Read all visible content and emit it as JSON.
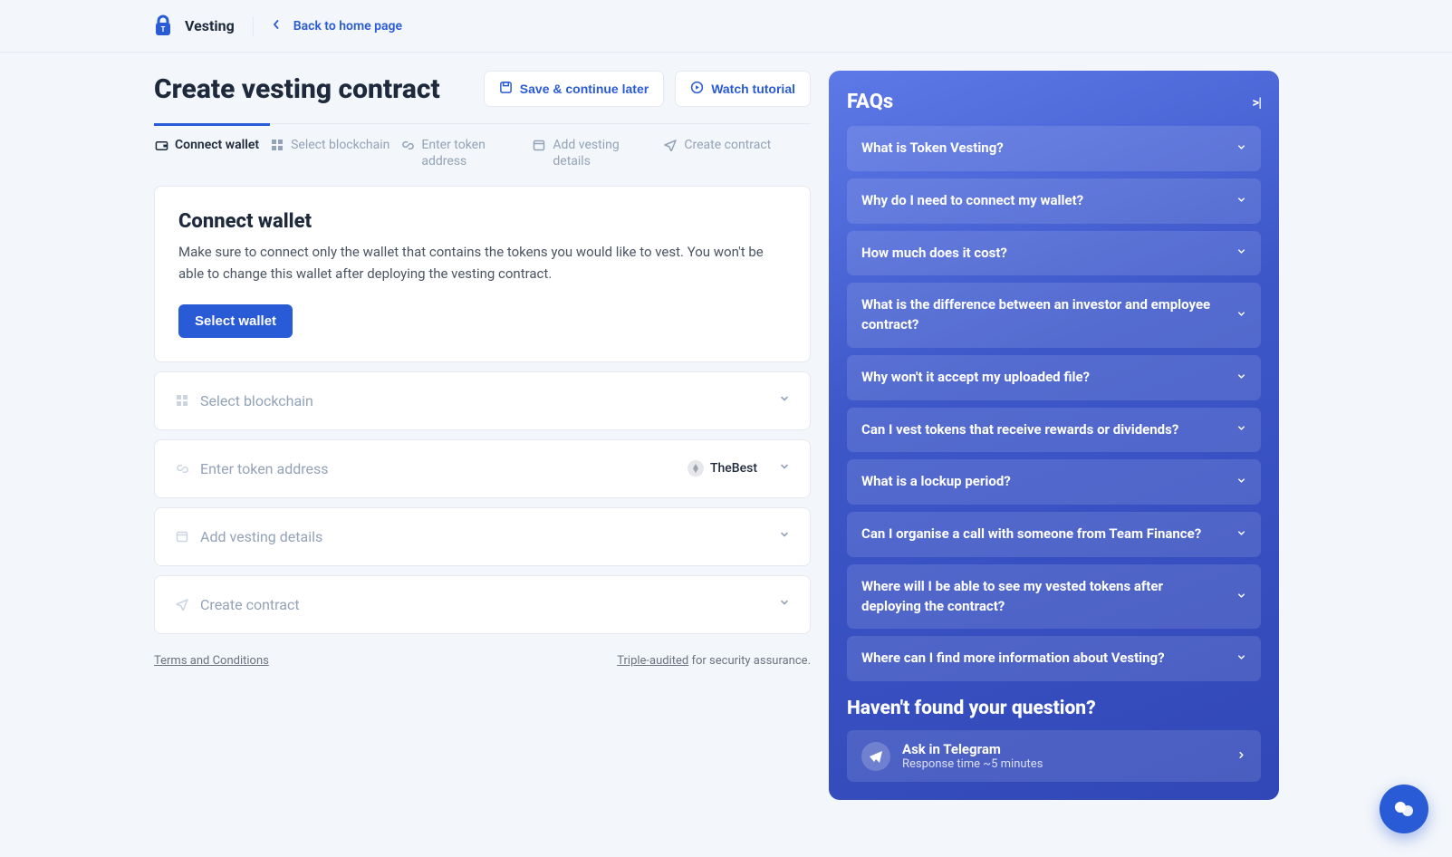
{
  "topbar": {
    "product": "Vesting",
    "back_label": "Back to home page"
  },
  "page": {
    "title": "Create vesting contract",
    "save_label": "Save & continue later",
    "tutorial_label": "Watch tutorial"
  },
  "steps": [
    {
      "label": "Connect wallet",
      "active": true
    },
    {
      "label": "Select blockchain",
      "active": false
    },
    {
      "label": "Enter token address",
      "active": false
    },
    {
      "label": "Add vesting details",
      "active": false
    },
    {
      "label": "Create contract",
      "active": false
    }
  ],
  "connect": {
    "heading": "Connect wallet",
    "description": "Make sure to connect only the wallet that contains the tokens you would like to vest. You won't be able to change this wallet after deploying the vesting contract.",
    "button": "Select wallet"
  },
  "rows": {
    "select_blockchain": "Select blockchain",
    "enter_token_address": "Enter token address",
    "token_name": "TheBest",
    "add_vesting_details": "Add vesting details",
    "create_contract": "Create contract"
  },
  "footer": {
    "terms": "Terms and Conditions",
    "audit_link": "Triple-audited",
    "audit_suffix": " for security assurance."
  },
  "faqs": {
    "title": "FAQs",
    "items": [
      "What is Token Vesting?",
      "Why do I need to connect my wallet?",
      "How much does it cost?",
      "What is the difference between an investor and employee contract?",
      "Why won't it accept my uploaded file?",
      "Can I vest tokens that receive rewards or dividends?",
      "What is a lockup period?",
      "Can I organise a call with someone from Team Finance?",
      "Where will I be able to see my vested tokens after deploying the contract?",
      "Where can I find more information about Vesting?"
    ],
    "not_found": "Haven't found your question?",
    "telegram_title": "Ask in Telegram",
    "telegram_sub": "Response time ~5 minutes"
  }
}
